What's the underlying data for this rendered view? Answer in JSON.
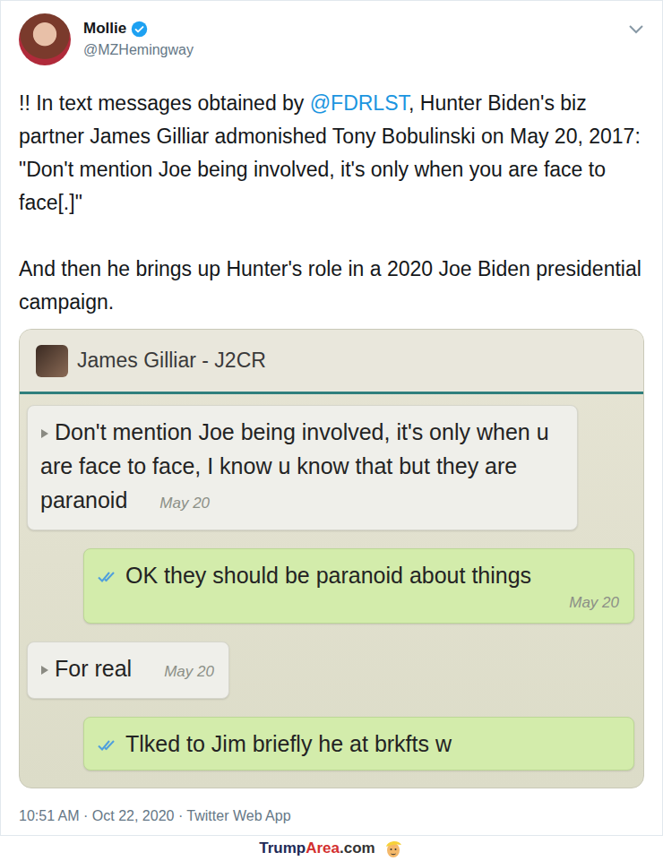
{
  "tweet": {
    "author": {
      "name": "Mollie",
      "handle": "@MZHemingway",
      "verified": true
    },
    "paragraphs": [
      [
        {
          "text": "!! In text messages obtained by ",
          "kind": "plain"
        },
        {
          "text": "@FDRLST",
          "kind": "mention"
        },
        {
          "text": ", Hunter Biden's biz partner James Gilliar admonished Tony Bobulinski on May 20, 2017: \"Don't mention Joe being involved, it's only when you are face to face[.]\"",
          "kind": "plain"
        }
      ],
      [
        {
          "text": "And then he brings up Hunter's role in a 2020 Joe Biden presidential campaign.",
          "kind": "plain"
        }
      ]
    ],
    "media": {
      "chat_title": "James Gilliar - J2CR",
      "messages": [
        {
          "kind": "incoming",
          "text": "Don't mention Joe being involved, it's only when u are face to face, I know u know that but they are paranoid",
          "time": "May 20",
          "read": false
        },
        {
          "kind": "outgoing",
          "text": "OK they should be paranoid about things",
          "time": "May 20",
          "read": true
        },
        {
          "kind": "incoming",
          "text": "For real",
          "time": "May 20",
          "read": false
        },
        {
          "kind": "outgoing",
          "text": "Tlked to Jim briefly he at brkfts w",
          "time": "",
          "read": true
        }
      ]
    },
    "timestamp": "10:51 AM · Oct 22, 2020 · Twitter Web App"
  },
  "watermark": {
    "parts": [
      {
        "text": "Trump",
        "color": "#1e2a57"
      },
      {
        "text": "Area",
        "color": "#d32f2f"
      },
      {
        "text": ".com",
        "color": "#333333"
      }
    ]
  }
}
